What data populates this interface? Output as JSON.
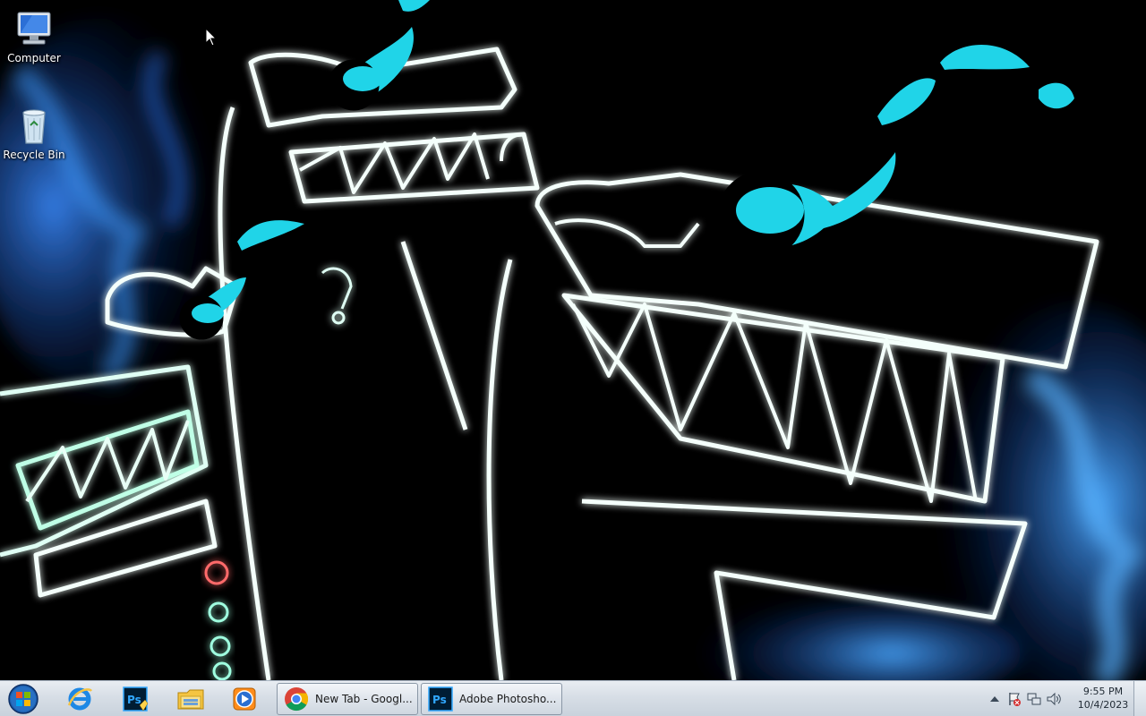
{
  "desktop": {
    "icons": [
      {
        "label": "Computer",
        "icon": "computer-icon"
      },
      {
        "label": "Recycle Bin",
        "icon": "recycle-bin-icon"
      }
    ]
  },
  "taskbar": {
    "start_icon": "windows-start-orb-icon",
    "pinned": [
      {
        "name": "Internet Explorer",
        "icon": "internet-explorer-icon"
      },
      {
        "name": "Adobe Photoshop",
        "icon": "photoshop-icon"
      },
      {
        "name": "Windows Explorer",
        "icon": "file-explorer-icon"
      },
      {
        "name": "Windows Media Player",
        "icon": "media-player-icon"
      }
    ],
    "tasks": [
      {
        "label": "New Tab - Googl...",
        "icon": "chrome-icon"
      },
      {
        "label": "Adobe Photosho...",
        "icon": "photoshop-icon"
      }
    ],
    "tray": {
      "icons": [
        "tray-expand-arrow-icon",
        "action-center-flag-icon",
        "network-icon",
        "volume-icon"
      ],
      "time": "9:55 PM",
      "date": "10/4/2023"
    }
  },
  "colors": {
    "neon_cyan": "#20d4e8",
    "neon_teal": "#18c0a0",
    "flame_blue": "#1e6cff",
    "taskbar_top": "#e9edf2",
    "taskbar_bottom": "#c9d2dc"
  }
}
